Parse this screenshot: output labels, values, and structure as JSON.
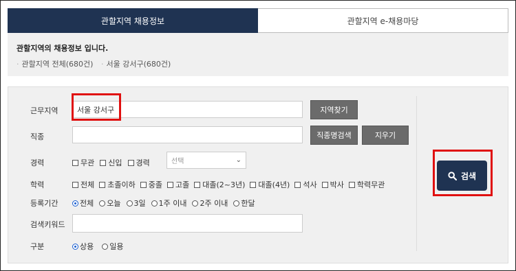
{
  "tabs": [
    {
      "label": "관할지역 채용정보",
      "active": true
    },
    {
      "label": "관할지역 e-채용마당",
      "active": false
    }
  ],
  "info": {
    "title": "관할지역의 채용정보 입니다.",
    "links": [
      "관할지역 전체(680건)",
      "서울 강서구(680건)"
    ]
  },
  "form": {
    "region": {
      "label": "근무지역",
      "value": "서울 강서구",
      "button": "지역찾기"
    },
    "job": {
      "label": "직종",
      "value": "",
      "button_search": "직종명검색",
      "button_clear": "지우기"
    },
    "career": {
      "label": "경력",
      "options": [
        "무관",
        "신입",
        "경력"
      ],
      "select_value": "선택"
    },
    "education": {
      "label": "학력",
      "options": [
        "전체",
        "초졸이하",
        "중졸",
        "고졸",
        "대졸(2~3년)",
        "대졸(4년)",
        "석사",
        "박사",
        "학력무관"
      ]
    },
    "period": {
      "label": "등록기간",
      "options": [
        "전체",
        "오늘",
        "3일",
        "1주 이내",
        "2주 이내",
        "한달"
      ],
      "selected": "전체"
    },
    "keyword": {
      "label": "검색키워드",
      "value": ""
    },
    "type": {
      "label": "구분",
      "options": [
        "상용",
        "일용"
      ],
      "selected": "상용"
    },
    "search_button": "검색"
  },
  "colors": {
    "navy": "#1f3352",
    "highlight_red": "#e01010",
    "button_gray": "#6b6b6b"
  }
}
